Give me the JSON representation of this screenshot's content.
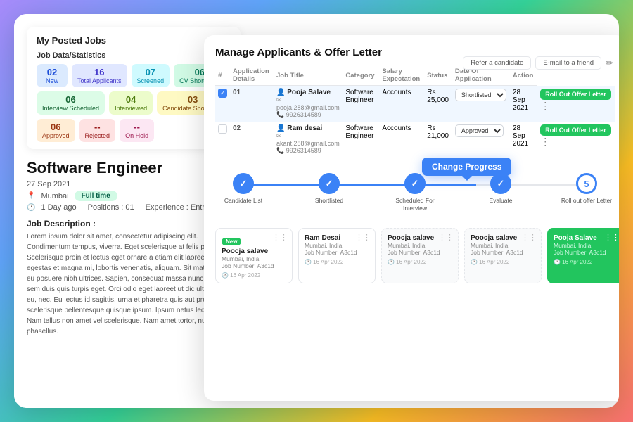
{
  "left": {
    "posted_jobs_title": "My Posted Jobs",
    "stats_label": "Job Data/Statistics",
    "stats": [
      {
        "num": "02",
        "lbl": "New",
        "class": "stat-blue"
      },
      {
        "num": "16",
        "lbl": "Total Applicants",
        "class": "stat-indigo"
      },
      {
        "num": "07",
        "lbl": "Screened",
        "class": "stat-cyan"
      },
      {
        "num": "06",
        "lbl": "CV Shortlisted",
        "class": "stat-teal"
      },
      {
        "num": "06",
        "lbl": "Interview Scheduled",
        "class": "stat-green"
      },
      {
        "num": "04",
        "lbl": "Interviewed",
        "class": "stat-lime"
      },
      {
        "num": "03",
        "lbl": "Candidate Shortlisted",
        "class": "stat-yellow"
      },
      {
        "num": "06",
        "lbl": "Approved",
        "class": "stat-orange"
      },
      {
        "num": "--",
        "lbl": "Rejected",
        "class": "stat-red"
      },
      {
        "num": "--",
        "lbl": "On Hold",
        "class": "stat-pink"
      }
    ],
    "job_title": "Software Engineer",
    "job_date": "27 Sep 2021",
    "job_location": "Mumbai",
    "job_type": "Full time",
    "job_ago": "1 Day ago",
    "job_positions": "Positions : 01",
    "job_experience": "Experience : Entry level",
    "job_desc_title": "Job Description :",
    "job_desc": "Lorem ipsum dolor sit amet, consectetur adipiscing elit. Condimentum tempus, viverra. Eget scelerisque at felis pulvinar. Scelerisque proin et lectus eget ornare a etiam elit laoreet. Senectus egestas et magna mi, lobortis venenatis, aliquam.\n\nSit mattis magna eu posuere nibh ultrices. Sapien, consequat massa nunc, lacus. Elit sem duis quis turpis eget. Orci odio eget laoreet ut dic ultrices diam eu, nec. Eu lectus id sagittis, urna et pharetra quis aut pretium scelerisque pellentesque quisque ipsum. Ipsum netus lectus eu.\n\nNam tellus non amet vel scelerisque. Nam amet tortor, nunc phasellus."
  },
  "actions": {
    "refer": "Refer a candidate",
    "email": "E-mail to a friend",
    "edit_icon": "✏"
  },
  "right": {
    "title": "Manage Applicants & Offer Letter",
    "table": {
      "headers": [
        "#",
        "Application Details",
        "Job Title",
        "Category",
        "Salary Expectation",
        "Status",
        "Date Of Application",
        "Action"
      ],
      "rows": [
        {
          "num": "01",
          "checked": true,
          "name": "Pooja Salave",
          "email": "pooja.288@gmail.com",
          "phone": "9926314589",
          "job_title": "Software Engineer",
          "category": "Accounts",
          "salary": "Rs 25,000",
          "status": "Shortlisted",
          "date": "28 Sep 2021",
          "action_btn": "Roll Out Offer Letter"
        },
        {
          "num": "02",
          "checked": false,
          "name": "Ram desai",
          "email": "akant.288@gmail.com",
          "phone": "9926314589",
          "job_title": "Software Engineer",
          "category": "Accounts",
          "salary": "Rs 21,000",
          "status": "Approved",
          "date": "28 Sep 2021",
          "action_btn": "Roll Out Offer Letter"
        }
      ]
    },
    "change_progress_label": "Change Progress",
    "steps": [
      {
        "label": "Candidate List",
        "state": "done",
        "icon": "✓"
      },
      {
        "label": "Shortlisted",
        "state": "done",
        "icon": "✓"
      },
      {
        "label": "Scheduled For Interview",
        "state": "done",
        "icon": "✓"
      },
      {
        "label": "Evaluate",
        "state": "done",
        "icon": "✓"
      },
      {
        "label": "Roll out offer Letter",
        "state": "active",
        "num": "5"
      }
    ],
    "cards": [
      {
        "type": "normal",
        "badge": "New",
        "name": "Poocja salave",
        "location": "Mumbai, India",
        "job_number": "Job Number: A3c1d",
        "date": "16 Apr 2022"
      },
      {
        "type": "normal",
        "name": "Ram Desai",
        "location": "Mumbai, India",
        "job_number": "Job Number: A3c1d",
        "date": "16 Apr 2022"
      },
      {
        "type": "dashed",
        "name": "Poocja salave",
        "location": "Mumbai, India",
        "job_number": "Job Number: A3c1d",
        "date": "16 Apr 2022"
      },
      {
        "type": "dashed",
        "name": "Poocja salave",
        "location": "Mumbai, India",
        "job_number": "Job Number: A3c1d",
        "date": "16 Apr 2022"
      },
      {
        "type": "green",
        "name": "Pooja Salave",
        "location": "Mumbai, India",
        "job_number": "Job Number: A3c1d",
        "date": "16 Apr 2022"
      }
    ]
  }
}
